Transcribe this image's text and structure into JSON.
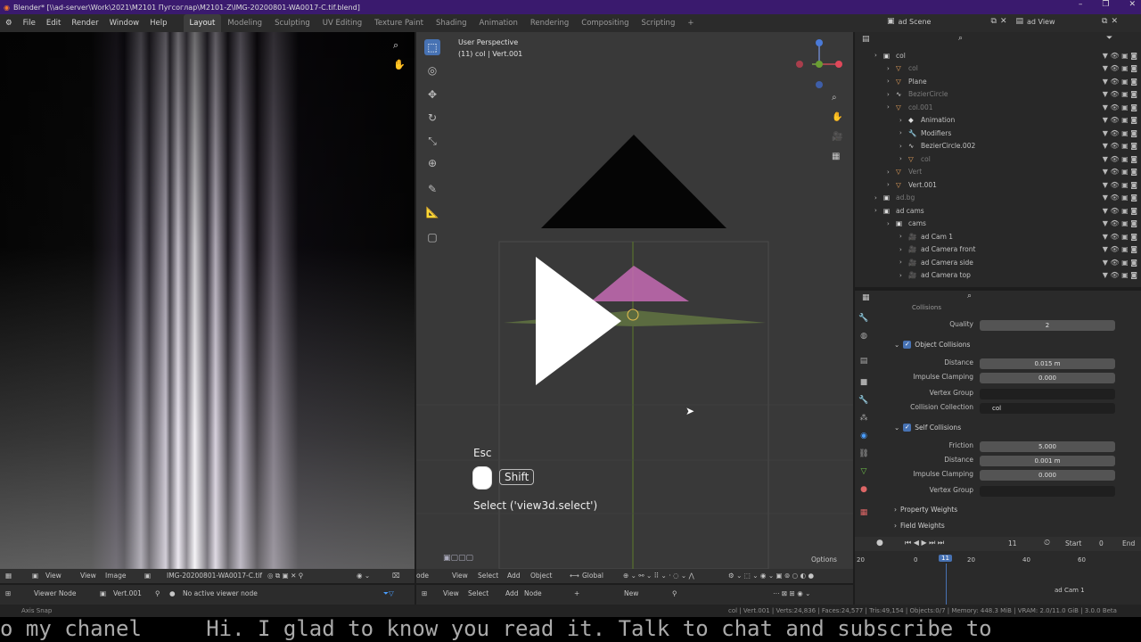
{
  "window": {
    "title": "Blender* [\\\\ad-server\\Work\\2021\\M2101 Пугсоглар\\M2101-Z\\IMG-20200801-WA0017-C.tif.blend]",
    "controls": [
      "–",
      "❐",
      "✕"
    ]
  },
  "menu": [
    "File",
    "Edit",
    "Render",
    "Window",
    "Help"
  ],
  "workspaces": [
    "Layout",
    "Modeling",
    "Sculpting",
    "UV Editing",
    "Texture Paint",
    "Shading",
    "Animation",
    "Rendering",
    "Compositing",
    "Scripting",
    "+"
  ],
  "scene": {
    "name": "ad Scene",
    "view_layer": "ad View"
  },
  "viewport": {
    "perspective_label": "User Perspective",
    "object_label": "(11) col | Vert.001",
    "tools": [
      "select-box",
      "cursor",
      "move",
      "rotate",
      "scale",
      "transform",
      "annotate",
      "measure",
      "add-cube"
    ],
    "nav_icons": [
      "zoom",
      "pan",
      "camera",
      "ortho"
    ],
    "overlay_keys": {
      "esc": "Esc",
      "shift": "Shift",
      "operator": "Select ('view3d.select')"
    },
    "options_label": "Options"
  },
  "outliner": {
    "items": [
      {
        "label": "col",
        "indent": 0,
        "muted": false,
        "icon": "collection"
      },
      {
        "label": "col",
        "indent": 1,
        "muted": true,
        "icon": "mesh"
      },
      {
        "label": "Plane",
        "indent": 1,
        "muted": false,
        "icon": "mesh"
      },
      {
        "label": "BezierCircle",
        "indent": 1,
        "muted": true,
        "icon": "curve"
      },
      {
        "label": "col.001",
        "indent": 1,
        "muted": true,
        "icon": "mesh"
      },
      {
        "label": "Animation",
        "indent": 2,
        "muted": false,
        "icon": "anim"
      },
      {
        "label": "Modifiers",
        "indent": 2,
        "muted": false,
        "icon": "wrench"
      },
      {
        "label": "BezierCircle.002",
        "indent": 2,
        "muted": false,
        "icon": "curve"
      },
      {
        "label": "col",
        "indent": 2,
        "muted": true,
        "icon": "mesh"
      },
      {
        "label": "Vert",
        "indent": 1,
        "muted": true,
        "icon": "mesh"
      },
      {
        "label": "Vert.001",
        "indent": 1,
        "muted": false,
        "icon": "mesh"
      },
      {
        "label": "ad.bg",
        "indent": 0,
        "muted": true,
        "icon": "collection"
      },
      {
        "label": "ad cams",
        "indent": 0,
        "muted": false,
        "icon": "collection"
      },
      {
        "label": "cams",
        "indent": 1,
        "muted": false,
        "icon": "collection"
      },
      {
        "label": "ad Cam 1",
        "indent": 2,
        "muted": false,
        "icon": "camera"
      },
      {
        "label": "ad Camera front",
        "indent": 2,
        "muted": false,
        "icon": "camera"
      },
      {
        "label": "ad Camera side",
        "indent": 2,
        "muted": false,
        "icon": "camera"
      },
      {
        "label": "ad Camera top",
        "indent": 2,
        "muted": false,
        "icon": "camera"
      }
    ]
  },
  "properties": {
    "header_section": "Collisions",
    "quality": {
      "label": "Quality",
      "value": "2"
    },
    "object_collisions": {
      "title": "Object Collisions",
      "distance": {
        "label": "Distance",
        "value": "0.015 m"
      },
      "impulse": {
        "label": "Impulse Clamping",
        "value": "0.000"
      },
      "vertex_group": {
        "label": "Vertex Group",
        "value": ""
      },
      "collision_collection": {
        "label": "Collision Collection",
        "value": "col"
      }
    },
    "self_collisions": {
      "title": "Self Collisions",
      "friction": {
        "label": "Friction",
        "value": "5.000"
      },
      "distance": {
        "label": "Distance",
        "value": "0.001 m"
      },
      "impulse": {
        "label": "Impulse Clamping",
        "value": "0.000"
      },
      "vertex_group": {
        "label": "Vertex Group",
        "value": ""
      }
    },
    "property_weights": "Property Weights",
    "field_weights": "Field Weights"
  },
  "timeline": {
    "current_frame": "11",
    "start_label": "Start",
    "start_value": "0",
    "end_label": "End",
    "ticks": [
      "20",
      "0",
      "20",
      "40",
      "60"
    ],
    "playhead_label": "11",
    "marker_label": "ad Cam 1"
  },
  "image_editor": {
    "menu": [
      "View",
      "View",
      "Image"
    ],
    "image_name": "IMG-20200801-WA0017-C.tif",
    "node_header": [
      "Viewer Node",
      "Vert.001",
      "No active viewer node"
    ]
  },
  "node_editor": {
    "mode": "ode",
    "menu": [
      "View",
      "Select",
      "Add",
      "Object"
    ],
    "transform": "Global",
    "menu2": [
      "View",
      "Select",
      "Add",
      "Node"
    ],
    "new_label": "New"
  },
  "status": {
    "left": "Axis Snap",
    "right": "col | Vert.001 | Verts:24,836 | Faces:24,577 | Tris:49,154 | Objects:0/7 | Memory: 448.3 MiB | VRAM: 2.0/11.0 GiB | 3.0.0 Beta"
  },
  "ticker": "o my chanel     Hi. I glad to know you read it. Talk to chat and subscribe to"
}
